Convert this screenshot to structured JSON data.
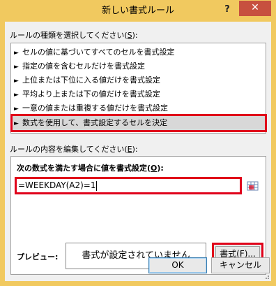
{
  "window": {
    "title": "新しい書式ルール",
    "help_label": "?",
    "close_label": "✕"
  },
  "rule_type": {
    "label_text": "ルールの種類を選択してください(",
    "label_key": "S",
    "label_suffix": "):",
    "items": [
      {
        "label": "セルの値に基づいてすべてのセルを書式設定"
      },
      {
        "label": "指定の値を含むセルだけを書式設定"
      },
      {
        "label": "上位または下位に入る値だけを書式設定"
      },
      {
        "label": "平均より上または下の値だけを書式設定"
      },
      {
        "label": "一意の値または重複する値だけを書式設定"
      },
      {
        "label": "数式を使用して、書式設定するセルを決定"
      }
    ],
    "arrow": "►"
  },
  "rule_edit": {
    "label_text": "ルールの内容を編集してください(",
    "label_key": "E",
    "label_suffix": "):",
    "formula_label_text": "次の数式を満たす場合に値を書式設定(",
    "formula_label_key": "O",
    "formula_label_suffix": "):",
    "formula_value": "=WEEKDAY(A2)=1",
    "preview_label": "プレビュー:",
    "preview_text": "書式が設定されていません",
    "format_button_text": "書式(",
    "format_button_key": "F",
    "format_button_suffix": ")..."
  },
  "buttons": {
    "ok": "OK",
    "cancel": "キャンセル"
  }
}
